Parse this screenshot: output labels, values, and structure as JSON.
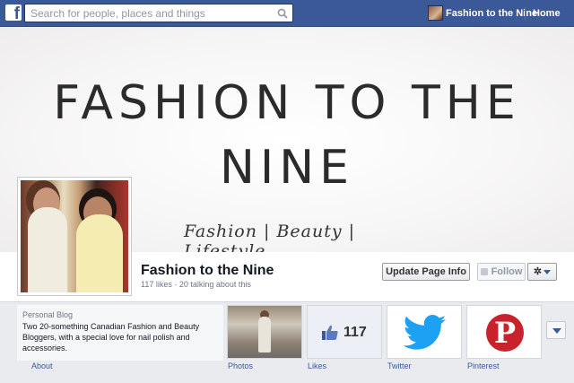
{
  "topbar": {
    "logo_letter": "f",
    "search_placeholder": "Search for people, places and things",
    "user_name": "Fashion to the Nine",
    "home_label": "Home"
  },
  "cover": {
    "title_line1": "FASHION TO THE",
    "title_line2": "NINE",
    "tagline": "Fashion | Beauty | Lifestyle"
  },
  "page": {
    "name": "Fashion to the Nine",
    "stats": "117 likes · 20 talking about this",
    "update_button": "Update Page Info",
    "follow_button": "Follow",
    "settings_icon": "gear-icon"
  },
  "about": {
    "category": "Personal Blog",
    "description": "Two 20-something Canadian Fashion and Beauty Bloggers, with a special love for nail polish and accessories.",
    "label": "About"
  },
  "apps": {
    "photos_label": "Photos",
    "likes_label": "Likes",
    "likes_count": "117",
    "twitter_label": "Twitter",
    "pinterest_label": "Pinterest"
  },
  "colors": {
    "brand_blue": "#3b5998",
    "twitter_blue": "#1da1f2",
    "pinterest_red": "#c8232c"
  }
}
